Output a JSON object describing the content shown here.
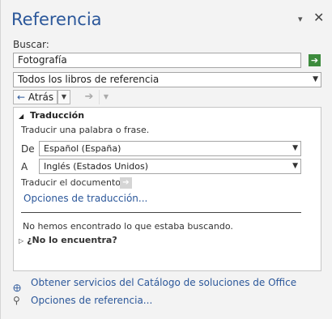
{
  "pane": {
    "title": "Referencia",
    "menu_glyph": "▾",
    "close_glyph": "✕"
  },
  "search": {
    "label": "Buscar:",
    "value": "Fotografía",
    "go_glyph": "➔",
    "go_color": "#3d8b3d"
  },
  "source": {
    "selected": "Todos los libros de referencia"
  },
  "nav": {
    "back_label": "Atrás",
    "back_glyph": "←",
    "forward_glyph": "➔"
  },
  "translation": {
    "section_title": "Traducción",
    "prompt": "Traducir una palabra o frase.",
    "from_label": "De",
    "from_value": "Español (España)",
    "to_label": "A",
    "to_value": "Inglés (Estados Unidos)",
    "doc_label": "Traducir el documento.",
    "options_link": "Opciones de traducción...",
    "not_found": "No hemos encontrado lo que estaba buscando.",
    "not_found_section": "¿No lo encuentra?"
  },
  "footer": {
    "catalog_link": "Obtener servicios del Catálogo de soluciones de Office",
    "options_link": "Opciones de referencia..."
  },
  "colors": {
    "accent": "#2b579a"
  }
}
